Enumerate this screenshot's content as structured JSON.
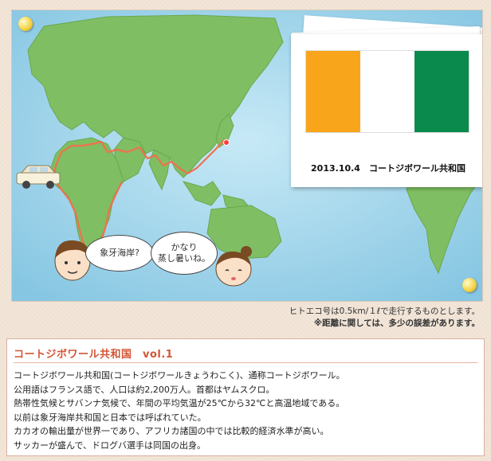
{
  "map_notes": {
    "line1": "ヒトエコ号は0.5km/１ℓで走行するものとします。",
    "line2": "※距離に関しては、多少の誤差があります。"
  },
  "photo": {
    "caption": "2013.10.4　コートジボワール共和国",
    "flag_colors": [
      "#f9a51b",
      "#ffffff",
      "#0b8a4d"
    ]
  },
  "bubbles": {
    "boy": "象牙海岸?",
    "girl_line1": "かなり",
    "girl_line2": "蒸し暑いね。"
  },
  "info": {
    "title": "コートジボワール共和国　vol.1",
    "lines": [
      "コートジボワール共和国(コートジボワールきょうわこく)、通称コートジボワール。",
      "公用語はフランス語で、人口は約2,200万人。首都はヤムスクロ。",
      "熱帯性気候とサバンナ気候で、年間の平均気温が25℃から32℃と高温地域である。",
      "以前は象牙海岸共和国と日本では呼ばれていた。",
      "カカオの輸出量が世界一であり、アフリカ諸国の中では比較的経済水準が高い。",
      "サッカーが盛んで、ドログバ選手は同国の出身。"
    ]
  },
  "colors": {
    "ocean": "#9fd3ea",
    "land": "#7fbe62",
    "route": "#f07050",
    "title_accent": "#d35535"
  }
}
